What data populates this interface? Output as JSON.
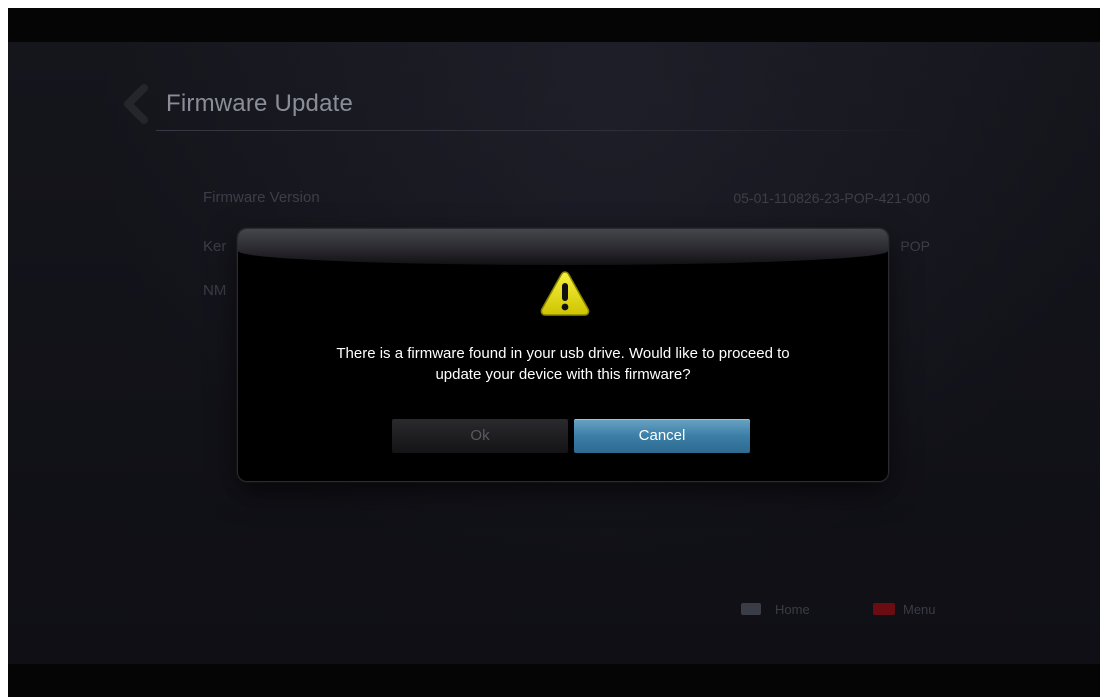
{
  "header": {
    "title": "Firmware Update"
  },
  "info": {
    "rows": [
      {
        "label": "Firmware Version",
        "value": "05-01-110826-23-POP-421-000"
      },
      {
        "label": "Ker",
        "value": "POP"
      },
      {
        "label": "NM",
        "value": ""
      }
    ]
  },
  "dialog": {
    "message_line1": "There is a firmware found in your usb drive. Would like to proceed to",
    "message_line2": "update your device with this firmware?",
    "ok_label": "Ok",
    "cancel_label": "Cancel",
    "icon": "warning-icon"
  },
  "footer": {
    "home_label": "Home",
    "menu_label": "Menu"
  },
  "colors": {
    "accent": "#3b7ea6",
    "warning": "#e8e000",
    "menu_key": "#6a0c12"
  }
}
